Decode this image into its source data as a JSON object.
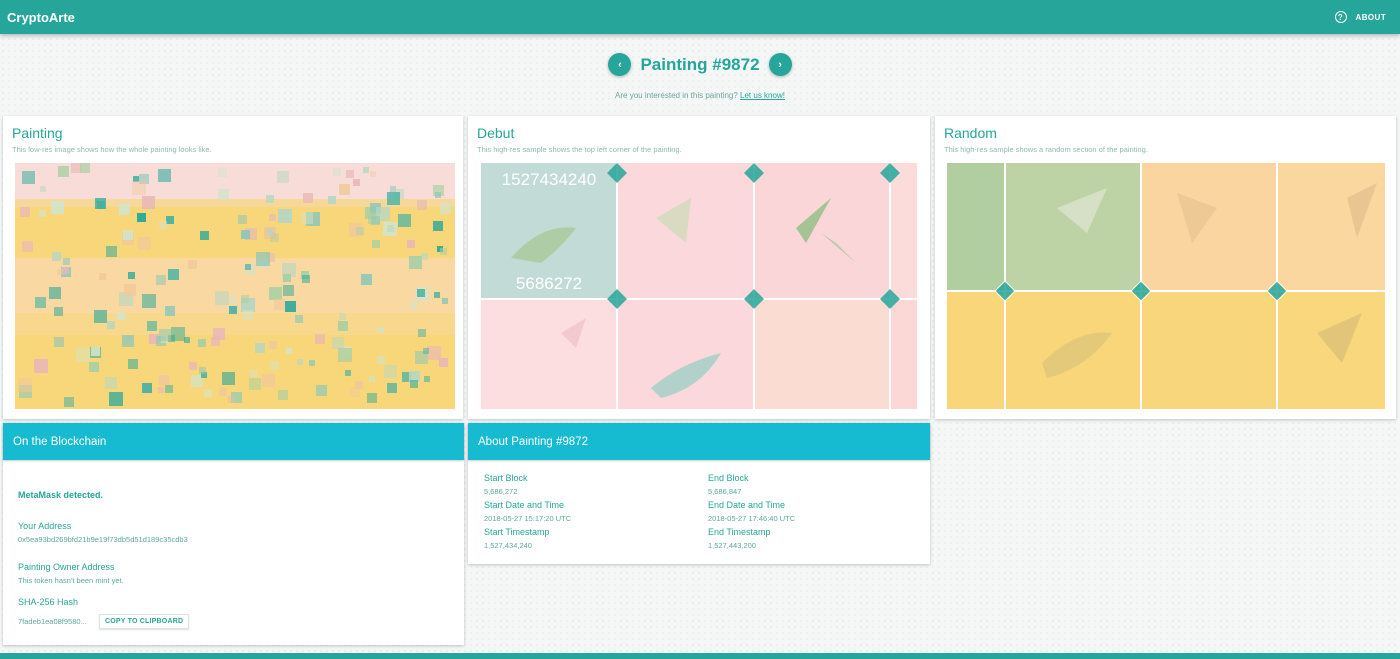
{
  "app": {
    "title": "CryptoArte",
    "about_label": "ABOUT"
  },
  "header": {
    "title": "Painting #9872",
    "interest_text": "Are you interested in this painting?",
    "interest_link": "Let us know!"
  },
  "cards": {
    "painting": {
      "title": "Painting",
      "subtitle": "This low-res image shows how the whole painting looks like."
    },
    "debut": {
      "title": "Debut",
      "subtitle": "This high-res sample shows the top left corner of the painting.",
      "top_number": "1527434240",
      "bottom_number": "5686272"
    },
    "random": {
      "title": "Random",
      "subtitle": "This high-res sample shows a random section of the painting."
    }
  },
  "blockchain": {
    "title": "On the Blockchain",
    "metamask": "MetaMask detected.",
    "your_address_label": "Your Address",
    "your_address": "0x5ea93bd269bfd21b9e19f73db5d51d189c35cdb3",
    "owner_label": "Painting Owner Address",
    "owner_value": "This token hasn't been mint yet.",
    "hash_label": "SHA-256 Hash",
    "hash_value": "7fadeb1ea08f9580...",
    "copy_label": "COPY TO CLIPBOARD"
  },
  "about_painting": {
    "title": "About Painting #9872",
    "start_block_label": "Start Block",
    "start_block": "5,686,272",
    "end_block_label": "End Block",
    "end_block": "5,686,847",
    "start_dt_label": "Start Date and Time",
    "start_dt": "2018-05-27 15:17:20 UTC",
    "end_dt_label": "End Date and Time",
    "end_dt": "2018-05-27 17:46:40 UTC",
    "start_ts_label": "Start Timestamp",
    "start_ts": "1,527,434,240",
    "end_ts_label": "End Timestamp",
    "end_ts": "1,527,443,200"
  },
  "colors": {
    "primary": "#26a69a",
    "header": "#17bbd1",
    "yellow": "#f9d97a",
    "peach": "#fbd9a4",
    "pink": "#fbdadc",
    "sage": "#b3cf9f",
    "teal_light": "#c4ddd9"
  },
  "icons": {
    "help": "help-circle-icon",
    "prev": "chevron-left-icon",
    "next": "chevron-right-icon"
  }
}
